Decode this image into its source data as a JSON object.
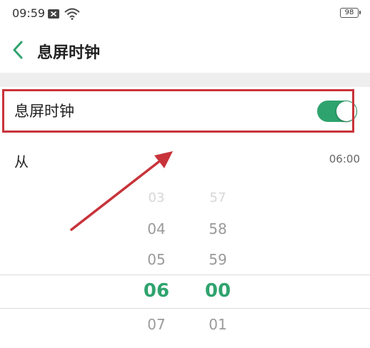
{
  "status_bar": {
    "time": "09:59",
    "battery": "98",
    "icons": [
      "notification-x-icon",
      "wifi-icon",
      "battery-icon"
    ]
  },
  "header": {
    "back_icon": "chevron-left-icon",
    "title": "息屏时钟"
  },
  "settings": {
    "toggle_label": "息屏时钟",
    "toggle_on": true,
    "from_label": "从",
    "from_value": "06:00"
  },
  "picker": {
    "hours": {
      "faint": "03",
      "above2": "04",
      "above1": "05",
      "selected": "06",
      "below1": "07"
    },
    "minutes": {
      "faint": "57",
      "above2": "58",
      "above1": "59",
      "selected": "00",
      "below1": "01"
    }
  },
  "colors": {
    "accent": "#2fa36e",
    "highlight_box": "#c8333a",
    "arrow": "#c8333a"
  }
}
